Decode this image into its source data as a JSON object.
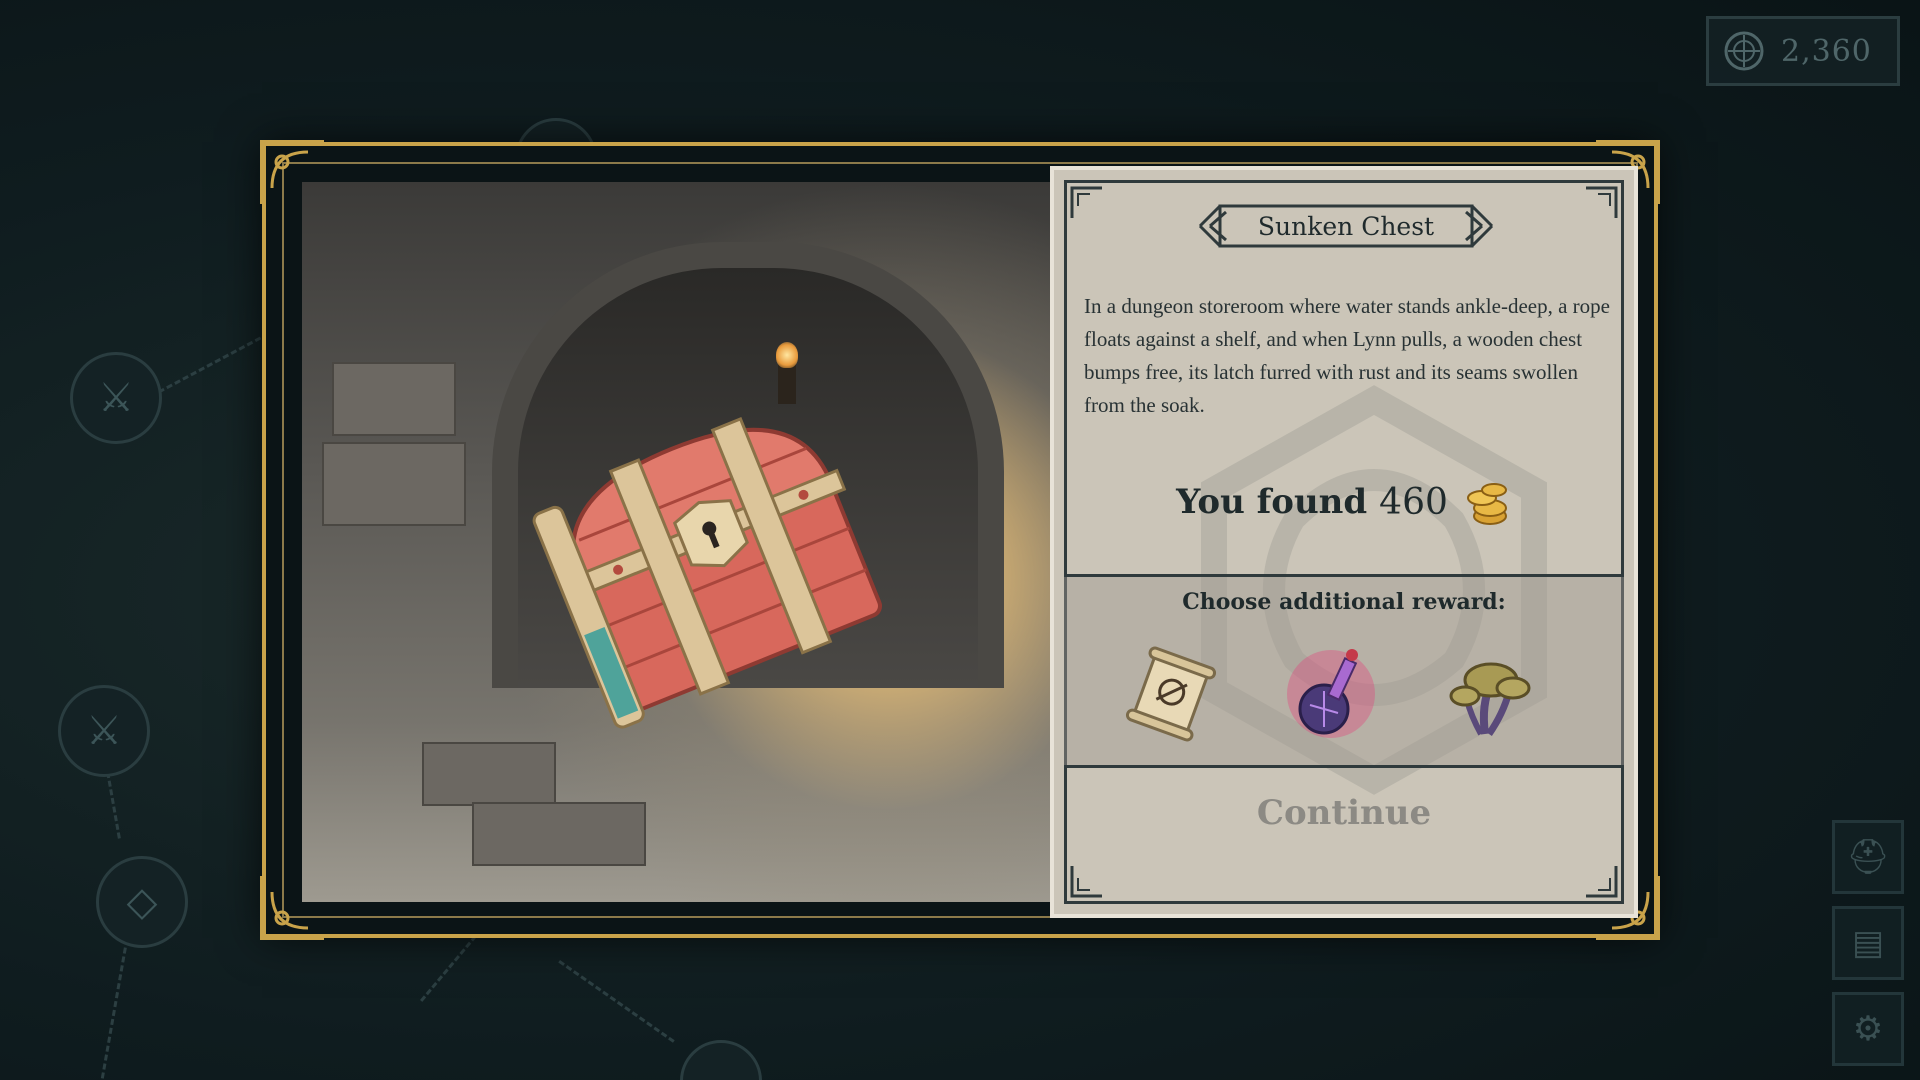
{
  "currency": {
    "amount": "2,360",
    "icon": "coin-medallion-icon"
  },
  "side_buttons": [
    {
      "name": "helmet",
      "icon": "helmet-icon",
      "glyph": "⛑"
    },
    {
      "name": "journal",
      "icon": "journal-icon",
      "glyph": "▤"
    },
    {
      "name": "settings",
      "icon": "gear-icon",
      "glyph": "⚙"
    }
  ],
  "event": {
    "title": "Sunken Chest",
    "description": "In a dungeon storeroom where water stands ankle-deep, a rope floats against a shelf, and when Lynn pulls, a wooden chest bumps free, its latch furred with rust and its seams swollen from the soak.",
    "found_label": "You found",
    "found_amount": "460",
    "found_icon": "gold-coins-icon",
    "reward_prompt": "Choose additional reward:",
    "rewards": [
      {
        "name": "scroll",
        "icon": "scroll-icon"
      },
      {
        "name": "potion",
        "icon": "potion-icon"
      },
      {
        "name": "mushroom",
        "icon": "mushroom-icon"
      }
    ],
    "continue_label": "Continue"
  },
  "colors": {
    "frame_gold": "#c9a34a",
    "panel_bg": "#cbc5b8",
    "text_dark": "#1f2a2c",
    "continue_disabled": "#8c8a84"
  }
}
